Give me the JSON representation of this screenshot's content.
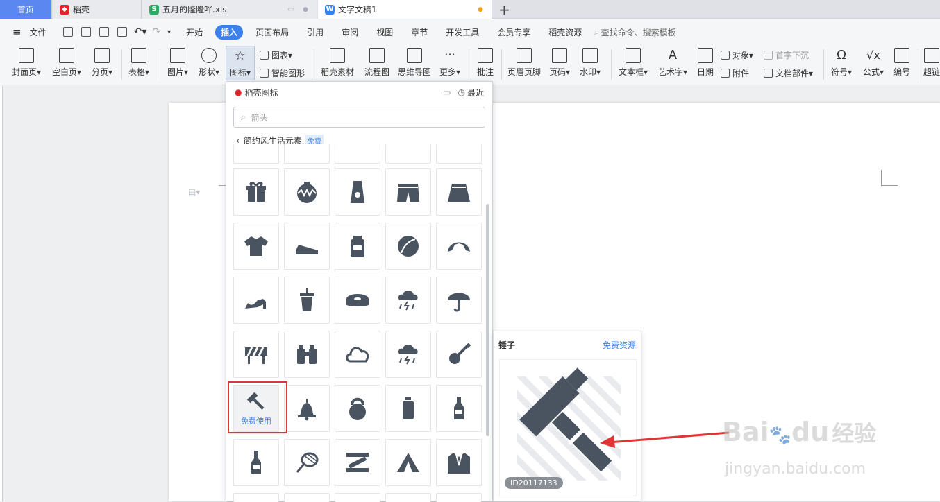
{
  "tabs": [
    {
      "label": "首页",
      "type": "home"
    },
    {
      "label": "稻壳",
      "type": "docer",
      "icon": "docer-logo-icon",
      "color": "#e1252a"
    },
    {
      "label": "五月的隆隆吖.xls",
      "type": "sheet",
      "icon": "spreadsheet-icon",
      "color": "#2eaa62"
    },
    {
      "label": "文字文稿1",
      "type": "writer",
      "icon": "writer-icon",
      "color": "#3c80ec",
      "active": true
    }
  ],
  "new_tab": "+",
  "menu": {
    "file": "文件",
    "items": [
      "开始",
      "插入",
      "页面布局",
      "引用",
      "审阅",
      "视图",
      "章节",
      "开发工具",
      "会员专享",
      "稻壳资源"
    ],
    "active": "插入",
    "search_placeholder": "查找命令、搜索模板"
  },
  "ribbon": {
    "cover": "封面页",
    "blank": "空白页",
    "pagebreak": "分页",
    "table": "表格",
    "picture": "图片",
    "shape": "形状",
    "icon": "图标",
    "chart": "图表",
    "smartart": "智能图形",
    "docer_material": "稻壳素材",
    "flowchart": "流程图",
    "mindmap": "思维导图",
    "more": "更多",
    "comment": "批注",
    "header_footer": "页眉页脚",
    "page_number": "页码",
    "watermark": "水印",
    "textbox": "文本框",
    "wordart": "艺术字",
    "date": "日期",
    "object": "对象",
    "attachment": "附件",
    "dropcap": "首字下沉",
    "docparts": "文档部件",
    "symbol": "符号",
    "formula": "公式",
    "numbering": "编号",
    "hyperlink": "超链"
  },
  "popup": {
    "title": "稻壳图标",
    "recent": "最近",
    "search_placeholder": "箭头",
    "category": "简约风生活元素",
    "category_badge": "免费",
    "icons": [
      "gift",
      "ornament",
      "sunscreen",
      "shorts",
      "skirt",
      "tshirt",
      "shoe",
      "jar",
      "beach-ball",
      "croissant",
      "high-heel",
      "cup",
      "tape",
      "thunder-rain",
      "umbrella",
      "barrier",
      "binoculars",
      "cloud",
      "storm",
      "guitar",
      "hammer",
      "bell",
      "kettlebell",
      "bottle",
      "beer",
      "wine",
      "badminton",
      "ruler",
      "tent",
      "suit"
    ],
    "selected_label": "免费使用"
  },
  "preview": {
    "title": "锤子",
    "link": "免费资源",
    "id": "ID20117133"
  },
  "watermark": {
    "brand_a": "Bai",
    "brand_b": "du",
    "brand_cn": "经验",
    "url": "jingyan.baidu.com"
  },
  "colors": {
    "accent": "#3c80ec",
    "icon": "#4a5461",
    "highlight": "#e03535"
  }
}
